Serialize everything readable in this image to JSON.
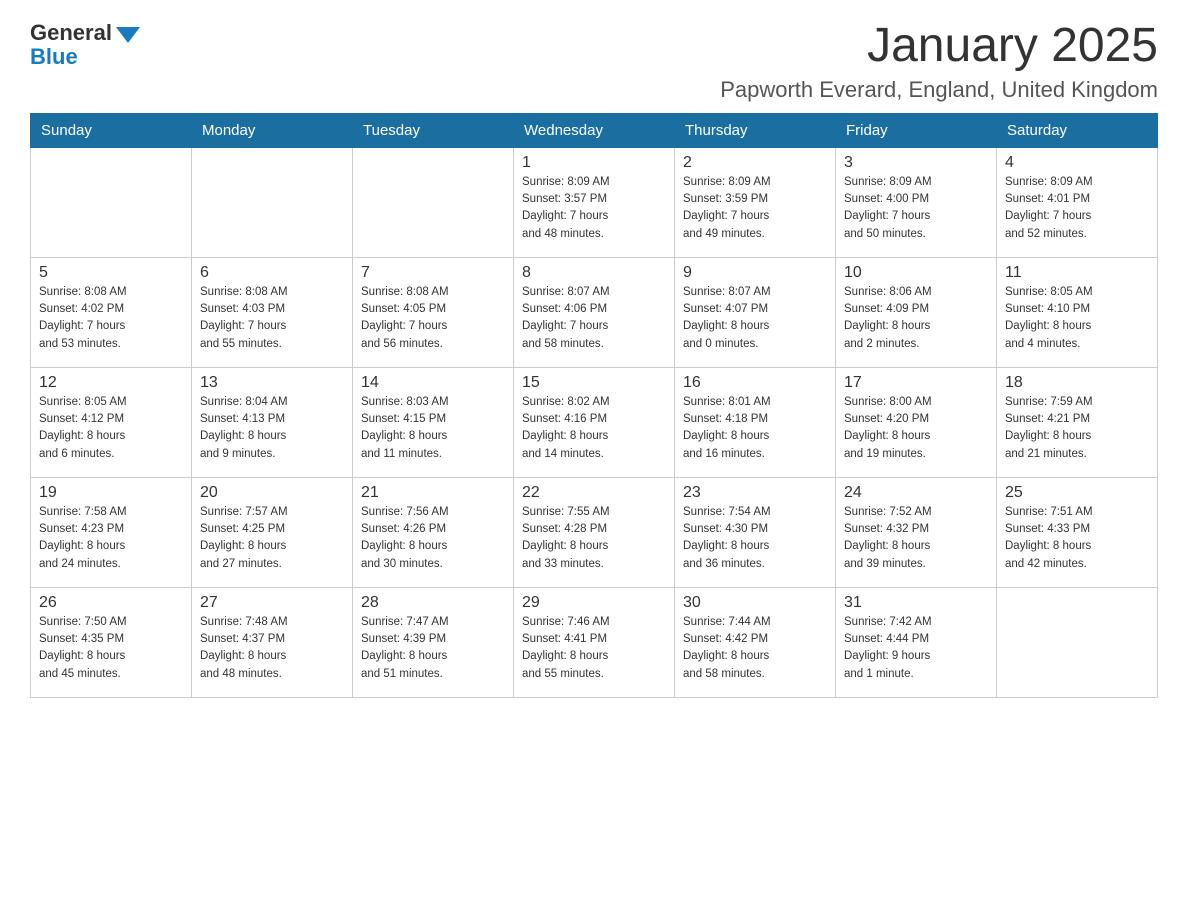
{
  "header": {
    "logo_general": "General",
    "logo_blue": "Blue",
    "month_title": "January 2025",
    "location": "Papworth Everard, England, United Kingdom"
  },
  "days_of_week": [
    "Sunday",
    "Monday",
    "Tuesday",
    "Wednesday",
    "Thursday",
    "Friday",
    "Saturday"
  ],
  "weeks": [
    {
      "days": [
        {
          "number": "",
          "info": ""
        },
        {
          "number": "",
          "info": ""
        },
        {
          "number": "",
          "info": ""
        },
        {
          "number": "1",
          "info": "Sunrise: 8:09 AM\nSunset: 3:57 PM\nDaylight: 7 hours\nand 48 minutes."
        },
        {
          "number": "2",
          "info": "Sunrise: 8:09 AM\nSunset: 3:59 PM\nDaylight: 7 hours\nand 49 minutes."
        },
        {
          "number": "3",
          "info": "Sunrise: 8:09 AM\nSunset: 4:00 PM\nDaylight: 7 hours\nand 50 minutes."
        },
        {
          "number": "4",
          "info": "Sunrise: 8:09 AM\nSunset: 4:01 PM\nDaylight: 7 hours\nand 52 minutes."
        }
      ]
    },
    {
      "days": [
        {
          "number": "5",
          "info": "Sunrise: 8:08 AM\nSunset: 4:02 PM\nDaylight: 7 hours\nand 53 minutes."
        },
        {
          "number": "6",
          "info": "Sunrise: 8:08 AM\nSunset: 4:03 PM\nDaylight: 7 hours\nand 55 minutes."
        },
        {
          "number": "7",
          "info": "Sunrise: 8:08 AM\nSunset: 4:05 PM\nDaylight: 7 hours\nand 56 minutes."
        },
        {
          "number": "8",
          "info": "Sunrise: 8:07 AM\nSunset: 4:06 PM\nDaylight: 7 hours\nand 58 minutes."
        },
        {
          "number": "9",
          "info": "Sunrise: 8:07 AM\nSunset: 4:07 PM\nDaylight: 8 hours\nand 0 minutes."
        },
        {
          "number": "10",
          "info": "Sunrise: 8:06 AM\nSunset: 4:09 PM\nDaylight: 8 hours\nand 2 minutes."
        },
        {
          "number": "11",
          "info": "Sunrise: 8:05 AM\nSunset: 4:10 PM\nDaylight: 8 hours\nand 4 minutes."
        }
      ]
    },
    {
      "days": [
        {
          "number": "12",
          "info": "Sunrise: 8:05 AM\nSunset: 4:12 PM\nDaylight: 8 hours\nand 6 minutes."
        },
        {
          "number": "13",
          "info": "Sunrise: 8:04 AM\nSunset: 4:13 PM\nDaylight: 8 hours\nand 9 minutes."
        },
        {
          "number": "14",
          "info": "Sunrise: 8:03 AM\nSunset: 4:15 PM\nDaylight: 8 hours\nand 11 minutes."
        },
        {
          "number": "15",
          "info": "Sunrise: 8:02 AM\nSunset: 4:16 PM\nDaylight: 8 hours\nand 14 minutes."
        },
        {
          "number": "16",
          "info": "Sunrise: 8:01 AM\nSunset: 4:18 PM\nDaylight: 8 hours\nand 16 minutes."
        },
        {
          "number": "17",
          "info": "Sunrise: 8:00 AM\nSunset: 4:20 PM\nDaylight: 8 hours\nand 19 minutes."
        },
        {
          "number": "18",
          "info": "Sunrise: 7:59 AM\nSunset: 4:21 PM\nDaylight: 8 hours\nand 21 minutes."
        }
      ]
    },
    {
      "days": [
        {
          "number": "19",
          "info": "Sunrise: 7:58 AM\nSunset: 4:23 PM\nDaylight: 8 hours\nand 24 minutes."
        },
        {
          "number": "20",
          "info": "Sunrise: 7:57 AM\nSunset: 4:25 PM\nDaylight: 8 hours\nand 27 minutes."
        },
        {
          "number": "21",
          "info": "Sunrise: 7:56 AM\nSunset: 4:26 PM\nDaylight: 8 hours\nand 30 minutes."
        },
        {
          "number": "22",
          "info": "Sunrise: 7:55 AM\nSunset: 4:28 PM\nDaylight: 8 hours\nand 33 minutes."
        },
        {
          "number": "23",
          "info": "Sunrise: 7:54 AM\nSunset: 4:30 PM\nDaylight: 8 hours\nand 36 minutes."
        },
        {
          "number": "24",
          "info": "Sunrise: 7:52 AM\nSunset: 4:32 PM\nDaylight: 8 hours\nand 39 minutes."
        },
        {
          "number": "25",
          "info": "Sunrise: 7:51 AM\nSunset: 4:33 PM\nDaylight: 8 hours\nand 42 minutes."
        }
      ]
    },
    {
      "days": [
        {
          "number": "26",
          "info": "Sunrise: 7:50 AM\nSunset: 4:35 PM\nDaylight: 8 hours\nand 45 minutes."
        },
        {
          "number": "27",
          "info": "Sunrise: 7:48 AM\nSunset: 4:37 PM\nDaylight: 8 hours\nand 48 minutes."
        },
        {
          "number": "28",
          "info": "Sunrise: 7:47 AM\nSunset: 4:39 PM\nDaylight: 8 hours\nand 51 minutes."
        },
        {
          "number": "29",
          "info": "Sunrise: 7:46 AM\nSunset: 4:41 PM\nDaylight: 8 hours\nand 55 minutes."
        },
        {
          "number": "30",
          "info": "Sunrise: 7:44 AM\nSunset: 4:42 PM\nDaylight: 8 hours\nand 58 minutes."
        },
        {
          "number": "31",
          "info": "Sunrise: 7:42 AM\nSunset: 4:44 PM\nDaylight: 9 hours\nand 1 minute."
        },
        {
          "number": "",
          "info": ""
        }
      ]
    }
  ]
}
